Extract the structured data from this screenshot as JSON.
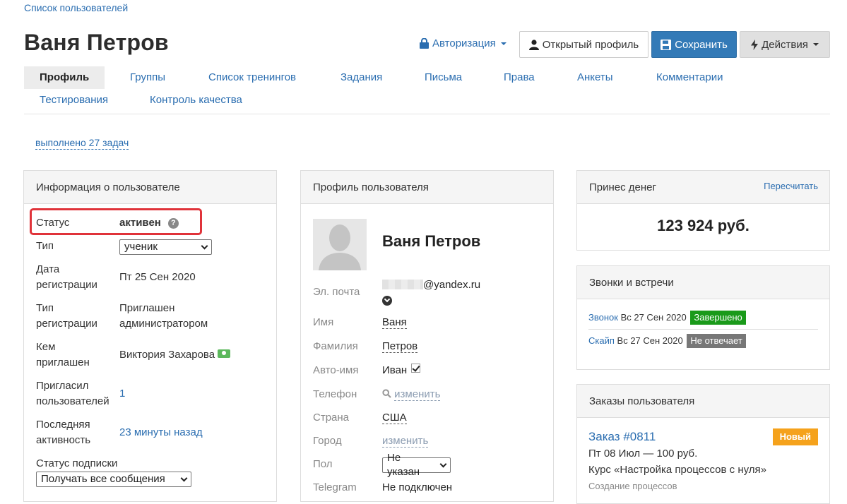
{
  "breadcrumb": "Список пользователей",
  "title": "Ваня Петров",
  "header": {
    "auth_label": "Авторизация",
    "open_profile_label": "Открытый профиль",
    "save_label": "Сохранить",
    "actions_label": "Действия"
  },
  "tabs": [
    {
      "label": "Профиль",
      "active": true
    },
    {
      "label": "Группы"
    },
    {
      "label": "Список тренингов"
    },
    {
      "label": "Задания"
    },
    {
      "label": "Письма"
    },
    {
      "label": "Права"
    },
    {
      "label": "Анкеты"
    },
    {
      "label": "Комментарии"
    },
    {
      "label": "Тестирования"
    },
    {
      "label": "Контроль качества"
    }
  ],
  "tasks_done": "выполнено 27 задач",
  "user_info": {
    "heading": "Информация о пользователе",
    "status_label": "Статус",
    "status_value": "активен",
    "type_label": "Тип",
    "type_value": "ученик",
    "reg_date_label_1": "Дата",
    "reg_date_label_2": "регистрации",
    "reg_date_value": "Пт 25 Сен 2020",
    "reg_type_label_1": "Тип",
    "reg_type_label_2": "регистрации",
    "reg_type_value_1": "Приглашен",
    "reg_type_value_2": "администратором",
    "invited_by_label_1": "Кем",
    "invited_by_label_2": "приглашен",
    "invited_by_value": "Виктория Захарова",
    "invited_users_label_1": "Пригласил",
    "invited_users_label_2": "пользователей",
    "invited_users_value": "1",
    "last_activity_label_1": "Последняя",
    "last_activity_label_2": "активность",
    "last_activity_value": "23 минуты назад",
    "subscription_label": "Статус подписки",
    "subscription_value": "Получать все сообщения"
  },
  "profile": {
    "heading": "Профиль пользователя",
    "name": "Ваня Петров",
    "email_label": "Эл. почта",
    "email_domain": "@yandex.ru",
    "first_name_label": "Имя",
    "first_name": "Ваня",
    "last_name_label": "Фамилия",
    "last_name": "Петров",
    "auto_name_label": "Авто-имя",
    "auto_name": "Иван",
    "phone_label": "Телефон",
    "phone_action": "изменить",
    "country_label": "Страна",
    "country": "США",
    "city_label": "Город",
    "city_action": "изменить",
    "gender_label": "Пол",
    "gender_value": "Не указан",
    "telegram_label": "Telegram",
    "telegram_value": "Не подключен"
  },
  "money": {
    "heading": "Принес денег",
    "recalc": "Пересчитать",
    "amount": "123 924 руб."
  },
  "calls": {
    "heading": "Звонки и встречи",
    "items": [
      {
        "type": "Звонок",
        "date": "Вс 27 Сен 2020",
        "status": "Завершено",
        "status_color": "#1a9a1a"
      },
      {
        "type": "Скайп",
        "date": "Вс 27 Сен 2020",
        "status": "Не отвечает",
        "status_color": "#777777"
      }
    ]
  },
  "orders": {
    "heading": "Заказы пользователя",
    "items": [
      {
        "number": "Заказ #0811",
        "status": "Новый",
        "line1": "Пт 08 Июл — 100 руб.",
        "line2": "Курс «Настройка процессов с нуля»",
        "line3": "Создание процессов"
      }
    ]
  }
}
